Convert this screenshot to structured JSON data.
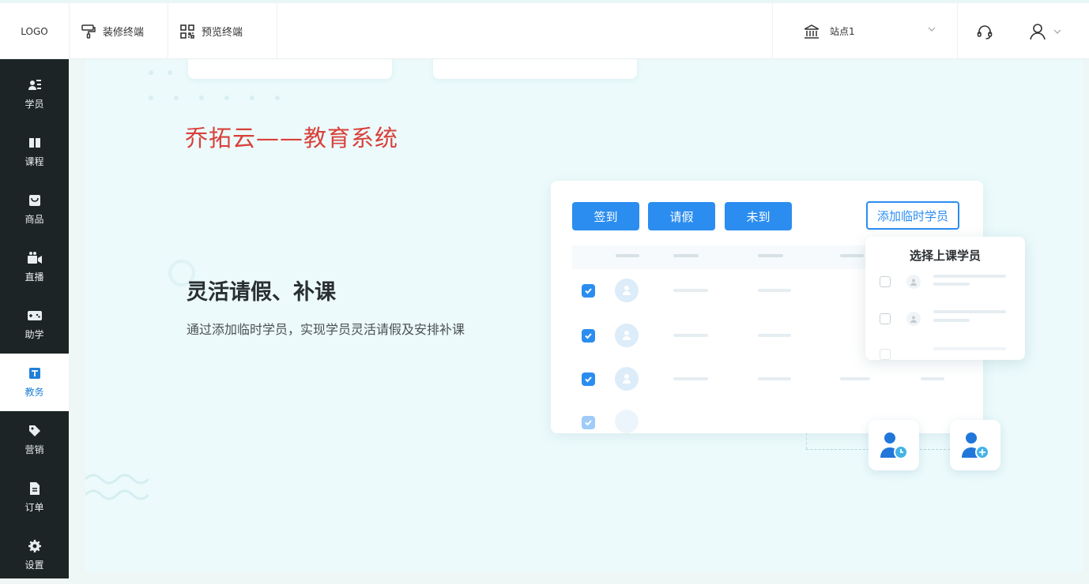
{
  "header": {
    "logo": "LOGO",
    "decorate_label": "装修终端",
    "preview_label": "预览终端",
    "site_label": "站点1",
    "icons": [
      "paint-roller-icon",
      "qr-code-icon",
      "bank-icon",
      "chevron-down-icon",
      "headset-icon",
      "user-icon"
    ]
  },
  "sidebar": {
    "items": [
      {
        "label": "学员",
        "icon": "students-icon"
      },
      {
        "label": "课程",
        "icon": "book-icon"
      },
      {
        "label": "商品",
        "icon": "bag-icon"
      },
      {
        "label": "直播",
        "icon": "video-icon"
      },
      {
        "label": "助学",
        "icon": "gamepad-icon"
      },
      {
        "label": "教务",
        "icon": "academic-icon",
        "active": true
      },
      {
        "label": "营销",
        "icon": "tag-icon"
      },
      {
        "label": "订单",
        "icon": "order-icon"
      },
      {
        "label": "设置",
        "icon": "gear-icon"
      }
    ]
  },
  "main": {
    "brand_title": "乔拓云——教育系统",
    "hero_title": "灵活请假、补课",
    "hero_desc": "通过添加临时学员，实现学员灵活请假及安排补课",
    "card": {
      "buttons": [
        "签到",
        "请假",
        "未到"
      ],
      "add_temp_button": "添加临时学员"
    },
    "popup": {
      "title": "选择上课学员"
    }
  },
  "colors": {
    "accent": "#2b8df0",
    "brand_red": "#d9403a",
    "sidebar_bg": "#1c2425",
    "active_text": "#1e7fd8"
  }
}
